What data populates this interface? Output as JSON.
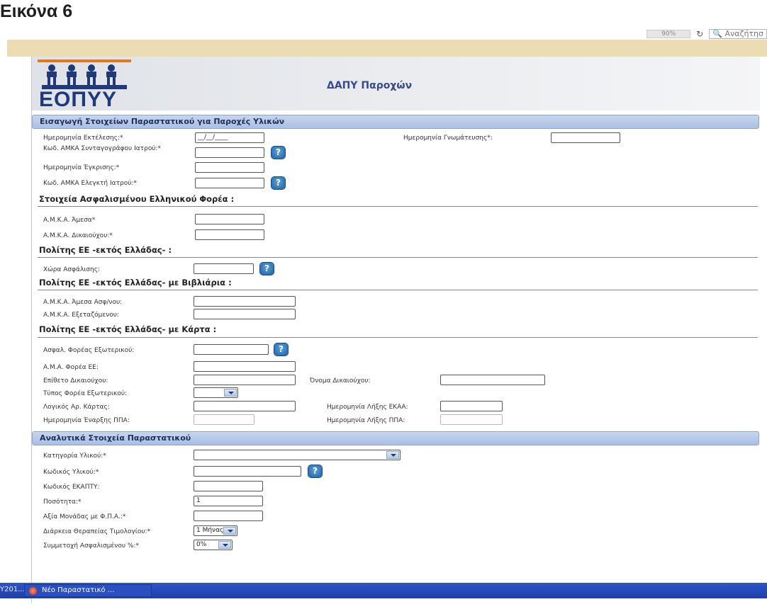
{
  "caption": "Εικόνα 6",
  "browser": {
    "zoom": "90%",
    "search_placeholder": "Αναζήτησ"
  },
  "header": {
    "logo_text": "ΕΟΠΥΥ",
    "title": "ΔΑΠΥ Παροχών"
  },
  "section1": {
    "title": "Εισαγωγή Στοιχείων Παραστατικού για Παροχές Υλικών",
    "fields": {
      "exec_date_label": "Ημερομηνία Εκτέλεσης:*",
      "exec_date_value": "__/__/____",
      "opinion_date_label": "Ημερομηνία Γνωμάτευσης*:",
      "prescriber_amka_label": "Κωδ. ΑΜΚΑ Συνταγογράφου Ιατρού:*",
      "approval_date_label": "Ημερομηνία Έγκρισης:*",
      "controller_amka_label": "Κωδ. ΑΜΚΑ Ελεγκτή Ιατρού:*"
    },
    "insured_title": "Στοιχεία Ασφαλισμένου Ελληνικού Φορέα :",
    "insured": {
      "direct_amka_label": "Α.Μ.Κ.Α. Άμεσα*",
      "beneficiary_amka_label": "Α.Μ.Κ.Α. Δικαιούχου:*"
    },
    "eu_title": "Πολίτης ΕΕ -εκτός Ελλάδας- :",
    "eu": {
      "country_label": "Χώρα Ασφάλισης:"
    },
    "eu_book_title": "Πολίτης ΕΕ -εκτός Ελλάδας- με Βιβλιάρια :",
    "eu_book": {
      "direct_amka_label": "Α.Μ.Κ.Α. Άμεσα Ασφ/νου:",
      "dependent_amka_label": "Α.Μ.Κ.Α. Εξεταζόμενου:"
    },
    "eu_card_title": "Πολίτης ΕΕ -εκτός Ελλάδας- με Κάρτα :",
    "eu_card": {
      "foreign_fund_label": "Ασφαλ. Φορέας Εξωτερικού:",
      "eu_ama_label": "Α.Μ.Α. Φορέα ΕΕ:",
      "surname_label": "Επίθετο Δικαιούχου:",
      "name_label": "Όνομα Δικαιούχου:",
      "fund_type_label": "Τύπος Φορέα Εξωτερικού:",
      "card_number_label": "Λογικός Αρ. Κάρτας:",
      "ekaa_expiry_label": "Ημερομηνία Λήξης ΕΚΑΑ:",
      "ppa_start_label": "Ημερομηνία Έναρξης ΠΠΑ:",
      "ppa_expiry_label": "Ημερομηνία Λήξης ΠΠΑ:"
    }
  },
  "section2": {
    "title": "Αναλυτικά Στοιχεία Παραστατικού",
    "fields": {
      "category_label": "Κατηγορία Υλικού:*",
      "code_label": "Κωδικός Υλικού:*",
      "ekapty_label": "Κωδικός ΕΚΑΠΤΥ:",
      "quantity_label": "Ποσότητα:*",
      "quantity_value": "1",
      "unit_value_label": "Αξία Μονάδας με Φ.Π.Α.:*",
      "duration_label": "Διάρκεια Θεραπείας Τιμολογίου:*",
      "duration_value": "1 Μήνας",
      "participation_label": "Συμμετοχή Ασφαλισμένου %:*",
      "participation_value": "0%"
    }
  },
  "help_symbol": "?",
  "taskbar": {
    "left_text": "Y201...",
    "item_label": "Νέο Παραστατικό ..."
  }
}
